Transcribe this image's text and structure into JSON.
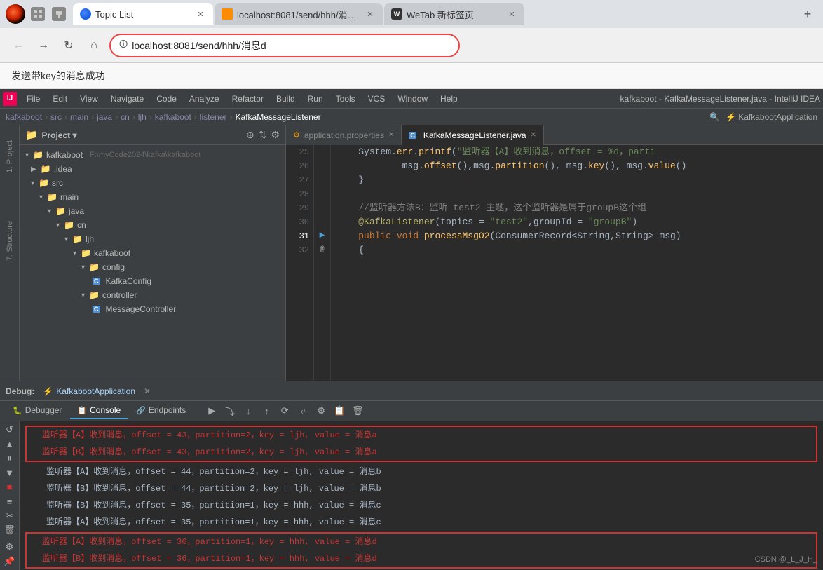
{
  "browser": {
    "tabs": [
      {
        "id": "tab1",
        "label": "Topic List",
        "url": "",
        "active": true,
        "favicon": "blue"
      },
      {
        "id": "tab2",
        "label": "localhost:8081/send/hhh/消息d",
        "url": "localhost:8081/send/hhh/消息d",
        "active": false,
        "favicon": "orange"
      },
      {
        "id": "tab3",
        "label": "WeTab 新标签页",
        "url": "",
        "active": false,
        "favicon": "wetab"
      }
    ],
    "url": "localhost:8081/send/hhh/消息d",
    "success_message": "发送带key的消息成功"
  },
  "ide": {
    "title": "kafkaboot - KafkaMessageListener.java - IntelliJ IDEA",
    "menubar": [
      "File",
      "Edit",
      "View",
      "Navigate",
      "Code",
      "Analyze",
      "Refactor",
      "Build",
      "Run",
      "Tools",
      "VCS",
      "Window",
      "Help"
    ],
    "breadcrumb": [
      "kafkaboot",
      "src",
      "main",
      "java",
      "cn",
      "ljh",
      "kafkaboot",
      "listener",
      "KafkaMessageListener"
    ],
    "project_panel": {
      "title": "Project",
      "root": "kafkaboot",
      "root_path": "F:\\myCode2024\\kafka\\kafkaboot",
      "tree": [
        {
          "label": ".idea",
          "type": "folder",
          "indent": 1,
          "collapsed": true
        },
        {
          "label": "src",
          "type": "folder",
          "indent": 1,
          "expanded": true
        },
        {
          "label": "main",
          "type": "folder",
          "indent": 2,
          "expanded": true
        },
        {
          "label": "java",
          "type": "folder",
          "indent": 3,
          "expanded": true
        },
        {
          "label": "cn",
          "type": "folder",
          "indent": 4,
          "expanded": true
        },
        {
          "label": "ljh",
          "type": "folder",
          "indent": 5,
          "expanded": true
        },
        {
          "label": "kafkaboot",
          "type": "folder",
          "indent": 6,
          "expanded": true
        },
        {
          "label": "config",
          "type": "folder",
          "indent": 7,
          "expanded": true
        },
        {
          "label": "KafkaConfig",
          "type": "java",
          "indent": 8
        },
        {
          "label": "controller",
          "type": "folder",
          "indent": 7,
          "expanded": true
        },
        {
          "label": "MessageController",
          "type": "java",
          "indent": 8
        }
      ]
    },
    "editor": {
      "tabs": [
        {
          "label": "application.properties",
          "type": "properties",
          "active": false
        },
        {
          "label": "KafkaMessageListener.java",
          "type": "java",
          "active": true
        }
      ],
      "lines": [
        {
          "num": 25,
          "content": "    System.err.printf(\"监听器【A】收到消息，offset = %d，parti",
          "type": "code"
        },
        {
          "num": 26,
          "content": "            msg.offset(),msg.partition(), msg.key(), msg.value()",
          "type": "code"
        },
        {
          "num": 27,
          "content": "    }",
          "type": "code"
        },
        {
          "num": 28,
          "content": "",
          "type": "code"
        },
        {
          "num": 29,
          "content": "    //监听器方法B：监听 test2 主题，这个监听器是属于groupB这个组",
          "type": "comment"
        },
        {
          "num": 30,
          "content": "    @KafkaListener(topics = \"test2\",groupId = \"groupB\")",
          "type": "code"
        },
        {
          "num": 31,
          "content": "    public void processMsgO2(ConsumerRecord<String,String> msg)",
          "type": "code"
        },
        {
          "num": 32,
          "content": "    {",
          "type": "code"
        }
      ]
    },
    "debug": {
      "label": "Debug:",
      "app_name": "KafkabootApplication",
      "tabs": [
        "Debugger",
        "Console",
        "Endpoints"
      ],
      "active_tab": "Console",
      "console_lines": [
        {
          "text": "监听器【A】收到消息，offset = 43，partition=2，key = ljh, value = 消息a",
          "highlighted": true
        },
        {
          "text": "监听器【B】收到消息，offset = 43，partition=2，key = ljh, value = 消息a",
          "highlighted": true
        },
        {
          "text": "监听器【A】收到消息，offset = 44，partition=2，key = ljh, value = 消息b",
          "highlighted": false
        },
        {
          "text": "监听器【B】收到消息，offset = 44，partition=2，key = ljh, value = 消息b",
          "highlighted": false
        },
        {
          "text": "监听器【B】收到消息，offset = 35，partition=1，key = hhh, value = 消息c",
          "highlighted": false
        },
        {
          "text": "监听器【A】收到消息，offset = 35，partition=1，key = hhh, value = 消息c",
          "highlighted": false
        },
        {
          "text": "监听器【A】收到消息，offset = 36，partition=1，key = hhh, value = 消息d",
          "highlighted": true
        },
        {
          "text": "监听器【B】收到消息，offset = 36，partition=1，key = hhh, value = 消息d",
          "highlighted": true
        }
      ]
    }
  },
  "watermark": "CSDN @_L_J_H_"
}
